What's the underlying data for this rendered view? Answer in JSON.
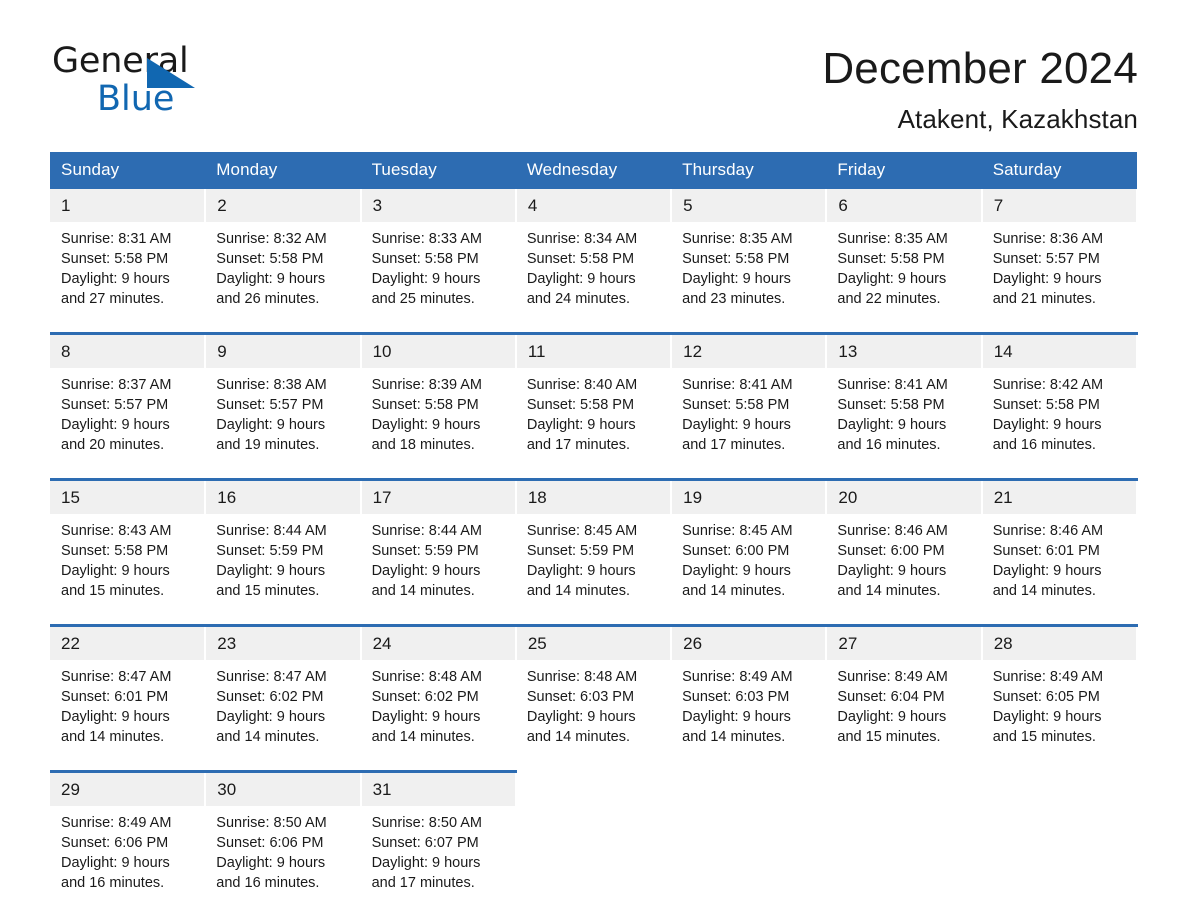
{
  "brand": {
    "name_part1": "General",
    "name_part2": "Blue",
    "accent_color": "#1167b1"
  },
  "header": {
    "title": "December 2024",
    "location": "Atakent, Kazakhstan"
  },
  "theme": {
    "header_blue": "#2d6cb2",
    "daynum_band": "#f0f0f0",
    "text": "#1a1a1a"
  },
  "weekdays": [
    "Sunday",
    "Monday",
    "Tuesday",
    "Wednesday",
    "Thursday",
    "Friday",
    "Saturday"
  ],
  "weeks": [
    [
      {
        "day": "1",
        "sunrise": "Sunrise: 8:31 AM",
        "sunset": "Sunset: 5:58 PM",
        "daylight1": "Daylight: 9 hours",
        "daylight2": "and 27 minutes."
      },
      {
        "day": "2",
        "sunrise": "Sunrise: 8:32 AM",
        "sunset": "Sunset: 5:58 PM",
        "daylight1": "Daylight: 9 hours",
        "daylight2": "and 26 minutes."
      },
      {
        "day": "3",
        "sunrise": "Sunrise: 8:33 AM",
        "sunset": "Sunset: 5:58 PM",
        "daylight1": "Daylight: 9 hours",
        "daylight2": "and 25 minutes."
      },
      {
        "day": "4",
        "sunrise": "Sunrise: 8:34 AM",
        "sunset": "Sunset: 5:58 PM",
        "daylight1": "Daylight: 9 hours",
        "daylight2": "and 24 minutes."
      },
      {
        "day": "5",
        "sunrise": "Sunrise: 8:35 AM",
        "sunset": "Sunset: 5:58 PM",
        "daylight1": "Daylight: 9 hours",
        "daylight2": "and 23 minutes."
      },
      {
        "day": "6",
        "sunrise": "Sunrise: 8:35 AM",
        "sunset": "Sunset: 5:58 PM",
        "daylight1": "Daylight: 9 hours",
        "daylight2": "and 22 minutes."
      },
      {
        "day": "7",
        "sunrise": "Sunrise: 8:36 AM",
        "sunset": "Sunset: 5:57 PM",
        "daylight1": "Daylight: 9 hours",
        "daylight2": "and 21 minutes."
      }
    ],
    [
      {
        "day": "8",
        "sunrise": "Sunrise: 8:37 AM",
        "sunset": "Sunset: 5:57 PM",
        "daylight1": "Daylight: 9 hours",
        "daylight2": "and 20 minutes."
      },
      {
        "day": "9",
        "sunrise": "Sunrise: 8:38 AM",
        "sunset": "Sunset: 5:57 PM",
        "daylight1": "Daylight: 9 hours",
        "daylight2": "and 19 minutes."
      },
      {
        "day": "10",
        "sunrise": "Sunrise: 8:39 AM",
        "sunset": "Sunset: 5:58 PM",
        "daylight1": "Daylight: 9 hours",
        "daylight2": "and 18 minutes."
      },
      {
        "day": "11",
        "sunrise": "Sunrise: 8:40 AM",
        "sunset": "Sunset: 5:58 PM",
        "daylight1": "Daylight: 9 hours",
        "daylight2": "and 17 minutes."
      },
      {
        "day": "12",
        "sunrise": "Sunrise: 8:41 AM",
        "sunset": "Sunset: 5:58 PM",
        "daylight1": "Daylight: 9 hours",
        "daylight2": "and 17 minutes."
      },
      {
        "day": "13",
        "sunrise": "Sunrise: 8:41 AM",
        "sunset": "Sunset: 5:58 PM",
        "daylight1": "Daylight: 9 hours",
        "daylight2": "and 16 minutes."
      },
      {
        "day": "14",
        "sunrise": "Sunrise: 8:42 AM",
        "sunset": "Sunset: 5:58 PM",
        "daylight1": "Daylight: 9 hours",
        "daylight2": "and 16 minutes."
      }
    ],
    [
      {
        "day": "15",
        "sunrise": "Sunrise: 8:43 AM",
        "sunset": "Sunset: 5:58 PM",
        "daylight1": "Daylight: 9 hours",
        "daylight2": "and 15 minutes."
      },
      {
        "day": "16",
        "sunrise": "Sunrise: 8:44 AM",
        "sunset": "Sunset: 5:59 PM",
        "daylight1": "Daylight: 9 hours",
        "daylight2": "and 15 minutes."
      },
      {
        "day": "17",
        "sunrise": "Sunrise: 8:44 AM",
        "sunset": "Sunset: 5:59 PM",
        "daylight1": "Daylight: 9 hours",
        "daylight2": "and 14 minutes."
      },
      {
        "day": "18",
        "sunrise": "Sunrise: 8:45 AM",
        "sunset": "Sunset: 5:59 PM",
        "daylight1": "Daylight: 9 hours",
        "daylight2": "and 14 minutes."
      },
      {
        "day": "19",
        "sunrise": "Sunrise: 8:45 AM",
        "sunset": "Sunset: 6:00 PM",
        "daylight1": "Daylight: 9 hours",
        "daylight2": "and 14 minutes."
      },
      {
        "day": "20",
        "sunrise": "Sunrise: 8:46 AM",
        "sunset": "Sunset: 6:00 PM",
        "daylight1": "Daylight: 9 hours",
        "daylight2": "and 14 minutes."
      },
      {
        "day": "21",
        "sunrise": "Sunrise: 8:46 AM",
        "sunset": "Sunset: 6:01 PM",
        "daylight1": "Daylight: 9 hours",
        "daylight2": "and 14 minutes."
      }
    ],
    [
      {
        "day": "22",
        "sunrise": "Sunrise: 8:47 AM",
        "sunset": "Sunset: 6:01 PM",
        "daylight1": "Daylight: 9 hours",
        "daylight2": "and 14 minutes."
      },
      {
        "day": "23",
        "sunrise": "Sunrise: 8:47 AM",
        "sunset": "Sunset: 6:02 PM",
        "daylight1": "Daylight: 9 hours",
        "daylight2": "and 14 minutes."
      },
      {
        "day": "24",
        "sunrise": "Sunrise: 8:48 AM",
        "sunset": "Sunset: 6:02 PM",
        "daylight1": "Daylight: 9 hours",
        "daylight2": "and 14 minutes."
      },
      {
        "day": "25",
        "sunrise": "Sunrise: 8:48 AM",
        "sunset": "Sunset: 6:03 PM",
        "daylight1": "Daylight: 9 hours",
        "daylight2": "and 14 minutes."
      },
      {
        "day": "26",
        "sunrise": "Sunrise: 8:49 AM",
        "sunset": "Sunset: 6:03 PM",
        "daylight1": "Daylight: 9 hours",
        "daylight2": "and 14 minutes."
      },
      {
        "day": "27",
        "sunrise": "Sunrise: 8:49 AM",
        "sunset": "Sunset: 6:04 PM",
        "daylight1": "Daylight: 9 hours",
        "daylight2": "and 15 minutes."
      },
      {
        "day": "28",
        "sunrise": "Sunrise: 8:49 AM",
        "sunset": "Sunset: 6:05 PM",
        "daylight1": "Daylight: 9 hours",
        "daylight2": "and 15 minutes."
      }
    ],
    [
      {
        "day": "29",
        "sunrise": "Sunrise: 8:49 AM",
        "sunset": "Sunset: 6:06 PM",
        "daylight1": "Daylight: 9 hours",
        "daylight2": "and 16 minutes."
      },
      {
        "day": "30",
        "sunrise": "Sunrise: 8:50 AM",
        "sunset": "Sunset: 6:06 PM",
        "daylight1": "Daylight: 9 hours",
        "daylight2": "and 16 minutes."
      },
      {
        "day": "31",
        "sunrise": "Sunrise: 8:50 AM",
        "sunset": "Sunset: 6:07 PM",
        "daylight1": "Daylight: 9 hours",
        "daylight2": "and 17 minutes."
      },
      {
        "day": "",
        "sunrise": "",
        "sunset": "",
        "daylight1": "",
        "daylight2": ""
      },
      {
        "day": "",
        "sunrise": "",
        "sunset": "",
        "daylight1": "",
        "daylight2": ""
      },
      {
        "day": "",
        "sunrise": "",
        "sunset": "",
        "daylight1": "",
        "daylight2": ""
      },
      {
        "day": "",
        "sunrise": "",
        "sunset": "",
        "daylight1": "",
        "daylight2": ""
      }
    ]
  ]
}
